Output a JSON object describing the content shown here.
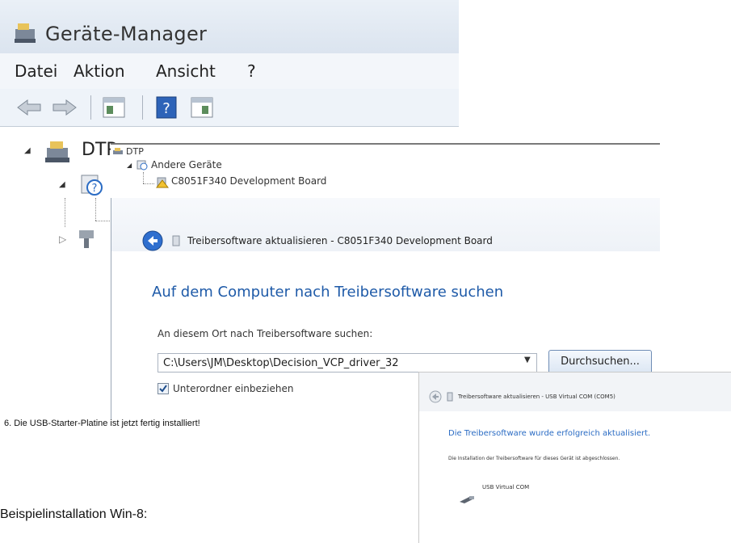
{
  "device_manager": {
    "title": "Geräte-Manager",
    "menu": [
      "Datei",
      "Aktion",
      "Ansicht",
      "?"
    ],
    "tree_root": "DTP"
  },
  "tree": {
    "root": "DTP",
    "group": "Andere Geräte",
    "device": "C8051F340 Development Board"
  },
  "driver_dialog": {
    "title": "Treibersoftware aktualisieren - C8051F340 Development Board",
    "heading": "Auf dem Computer nach Treibersoftware suchen",
    "search_label": "An diesem Ort nach Treibersoftware suchen:",
    "path_value": "C:\\Users\\JM\\Desktop\\Decision_VCP_driver_32",
    "browse_button": "Durchsuchen...",
    "subfolder_checkbox": "Unterordner einbeziehen",
    "subfolder_checked": true
  },
  "success_dialog": {
    "title": "Treibersoftware aktualisieren - USB Virtual COM (COM5)",
    "heading": "Die Treibersoftware wurde erfolgreich aktualisiert.",
    "message": "Die Installation der Treibersoftware für dieses Gerät ist abgeschlossen.",
    "device_name": "USB Virtual COM"
  },
  "captions": {
    "step6": "6. Die USB-Starter-Platine ist jetzt fertig installiert!",
    "win8": "Beispielinstallation Win-8:"
  },
  "colors": {
    "heading_blue": "#1e5aa8",
    "accent": "#2b6cc4"
  }
}
